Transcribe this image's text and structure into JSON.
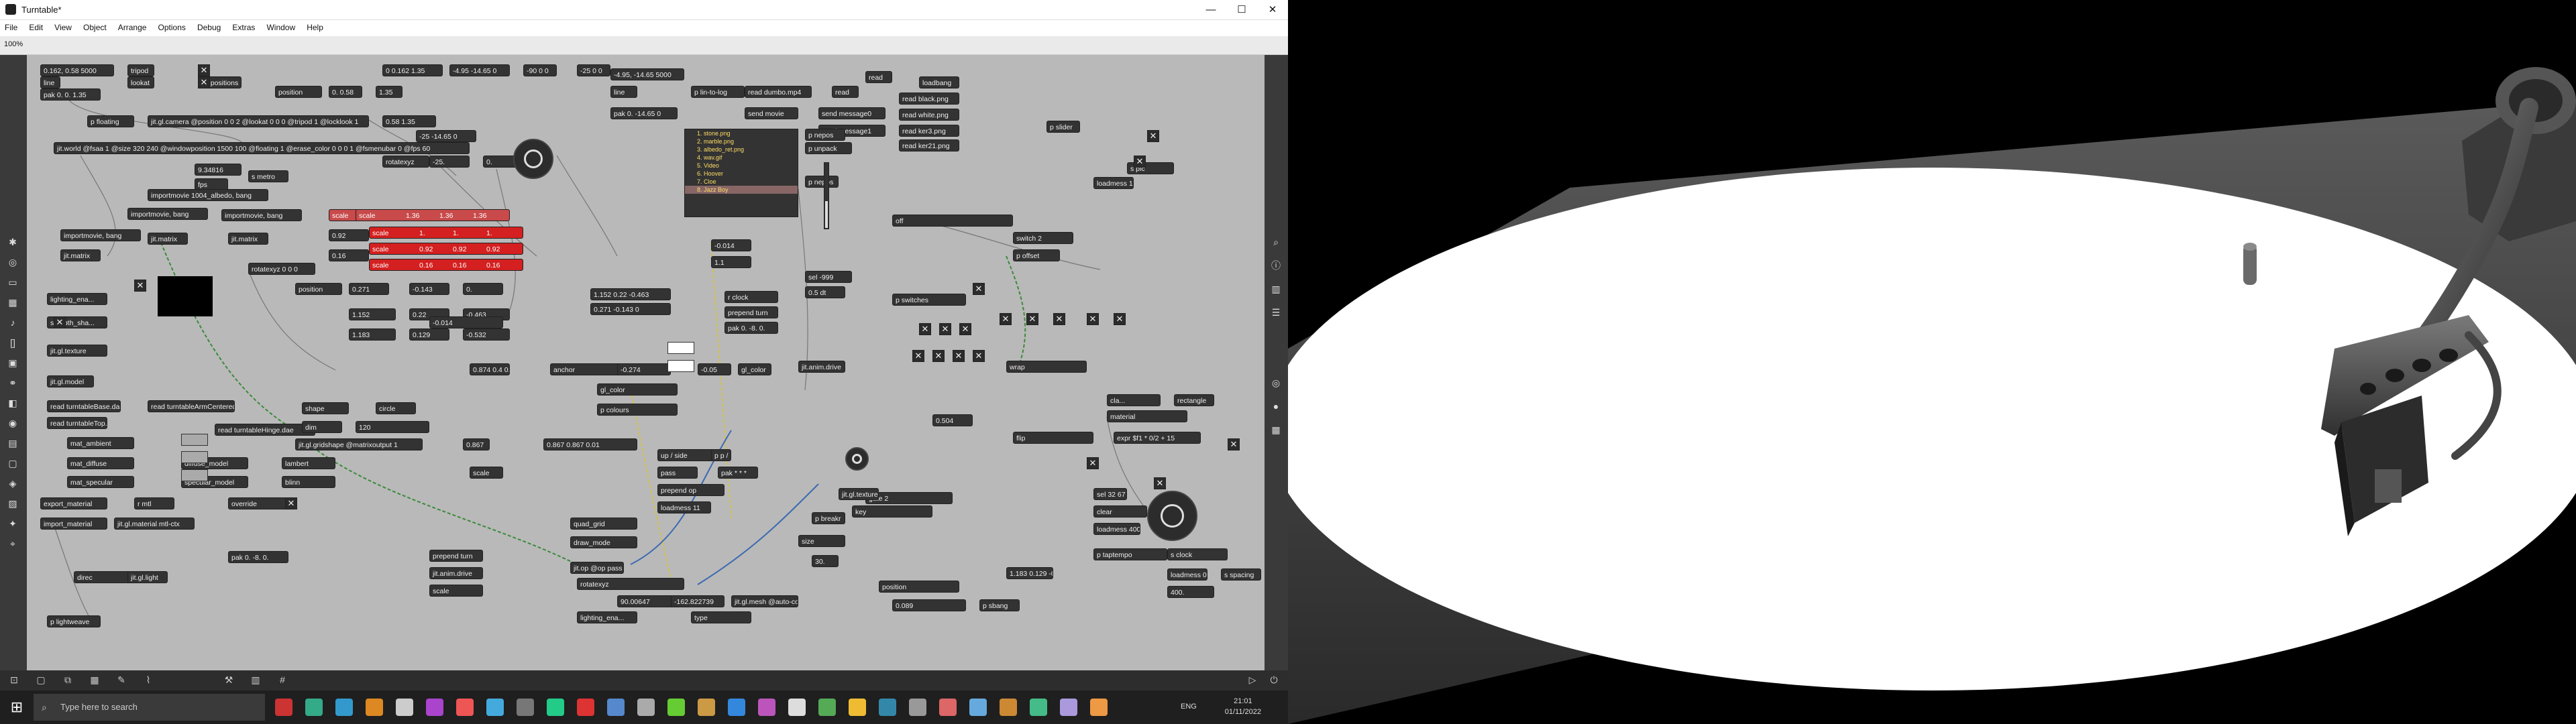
{
  "window": {
    "title": "Turntable*",
    "minimize": "—",
    "maximize": "☐",
    "close": "✕"
  },
  "menu": [
    "File",
    "Edit",
    "View",
    "Object",
    "Arrange",
    "Options",
    "Debug",
    "Extras",
    "Window",
    "Help"
  ],
  "toolbar": {
    "zoom": "100%"
  },
  "patch": {
    "objects": [
      {
        "t": "0.162, 0.58 5000"
      },
      {
        "t": "tripod"
      },
      {
        "t": "line"
      },
      {
        "t": "lookat"
      },
      {
        "t": "pak 0. 0. 1.35"
      },
      {
        "t": "p positions"
      },
      {
        "t": "position"
      },
      {
        "t": "0. 0.58"
      },
      {
        "t": "1.35"
      },
      {
        "t": "0 0.162 1.35"
      },
      {
        "t": "-4.95 -14.65 0"
      },
      {
        "t": "-90 0 0"
      },
      {
        "t": "-25 0 0"
      },
      {
        "t": "-4.95, -14.65 5000"
      },
      {
        "t": "line"
      },
      {
        "t": "pak 0. -14.65 0"
      },
      {
        "t": "p lin-to-log"
      },
      {
        "t": "read dumbo.mp4"
      },
      {
        "t": "send movie"
      },
      {
        "t": "send message0"
      },
      {
        "t": "send message1"
      },
      {
        "t": "read"
      },
      {
        "t": "read"
      },
      {
        "t": "loadbang"
      },
      {
        "t": "read black.png"
      },
      {
        "t": "read white.png"
      },
      {
        "t": "read ker3.png"
      },
      {
        "t": "read ker21.png"
      },
      {
        "t": "p floating"
      },
      {
        "t": "jit.gl.camera @position 0 0 2 @lookat 0 0 0 @tripod 1 @locklook 1"
      },
      {
        "t": "jit.world @fsaa 1 @size 320 240 @windowposition 1500 100 @floating 1 @erase_color 0 0 0 1 @fsmenubar 0 @fps 60"
      },
      {
        "t": "9.34816"
      },
      {
        "t": "fps"
      },
      {
        "t": "s metro"
      },
      {
        "t": "0.58 1.35"
      },
      {
        "t": "-25 -14.65 0"
      },
      {
        "t": "rotatexyz"
      },
      {
        "t": "-25."
      },
      {
        "t": "0."
      },
      {
        "t": "importmovie 1004_albedo, bang"
      },
      {
        "t": "importmovie, bang"
      },
      {
        "t": "importmovie, bang"
      },
      {
        "t": "importmovie, bang"
      },
      {
        "t": "jit.matrix"
      },
      {
        "t": "jit.matrix"
      },
      {
        "t": "jit.matrix"
      },
      {
        "t": "scale"
      },
      {
        "t": "1.36"
      },
      {
        "t": "0.92"
      },
      {
        "t": "0.16"
      },
      {
        "t": "rotatexyz 0 0 0"
      },
      {
        "t": "position"
      },
      {
        "t": "0.271"
      },
      {
        "t": "-0.143"
      },
      {
        "t": "0."
      },
      {
        "t": "1.152"
      },
      {
        "t": "0.22"
      },
      {
        "t": "-0.463"
      },
      {
        "t": "1.183"
      },
      {
        "t": "0.129"
      },
      {
        "t": "-0.532"
      },
      {
        "t": "lighting_ena..."
      },
      {
        "t": "smooth_sha..."
      },
      {
        "t": "jit.gl.texture"
      },
      {
        "t": "jit.gl.model"
      },
      {
        "t": "read turntableBase.dae"
      },
      {
        "t": "read turntableTop.dae"
      },
      {
        "t": "read turntableArmCentered.dae"
      },
      {
        "t": "read turntableHinge.dae"
      },
      {
        "t": "mat_ambient"
      },
      {
        "t": "mat_diffuse"
      },
      {
        "t": "mat_specular"
      },
      {
        "t": "diffuse_model"
      },
      {
        "t": "lambert"
      },
      {
        "t": "specular_model"
      },
      {
        "t": "blinn"
      },
      {
        "t": "export_material"
      },
      {
        "t": "import_material"
      },
      {
        "t": "override"
      },
      {
        "t": "r mtl"
      },
      {
        "t": "jit.gl.material mtl-ctx"
      },
      {
        "t": "shape"
      },
      {
        "t": "circle"
      },
      {
        "t": "dim"
      },
      {
        "t": "120"
      },
      {
        "t": "jit.gl.gridshape @matrixoutput 1"
      },
      {
        "t": "0.867"
      },
      {
        "t": "0.867 0.867 0.01"
      },
      {
        "t": "scale"
      },
      {
        "t": "up / side"
      },
      {
        "t": "p p /"
      },
      {
        "t": "pass"
      },
      {
        "t": "pak * * *"
      },
      {
        "t": "prepend op"
      },
      {
        "t": "loadmess 11"
      },
      {
        "t": "quad_grid"
      },
      {
        "t": "draw_mode"
      },
      {
        "t": "jit.op @op pass + pass"
      },
      {
        "t": "rotatexyz"
      },
      {
        "t": "90.00647"
      },
      {
        "t": "-162.822739"
      },
      {
        "t": "jit.gl.mesh @auto-colors 1"
      },
      {
        "t": "lighting_ena..."
      },
      {
        "t": "type"
      },
      {
        "t": "direc"
      },
      {
        "t": "jit.gl.light"
      },
      {
        "t": "p lightweave"
      },
      {
        "t": "pak 0. -8. 0."
      },
      {
        "t": "prepend turn"
      },
      {
        "t": "jit.anim.drive"
      },
      {
        "t": "scale"
      },
      {
        "t": "0.874 0.4 0.41"
      },
      {
        "t": "anchor"
      },
      {
        "t": "-0.274"
      },
      {
        "t": "-0.05"
      },
      {
        "t": "gl_color"
      },
      {
        "t": "gl_color"
      },
      {
        "t": "p colours"
      },
      {
        "t": "off"
      },
      {
        "t": "switch 2"
      },
      {
        "t": "p offset"
      },
      {
        "t": "p switches"
      },
      {
        "t": "wrap"
      },
      {
        "t": "cla..."
      },
      {
        "t": "rectangle"
      },
      {
        "t": "material"
      },
      {
        "t": "flip"
      },
      {
        "t": "expr $f1 * 0/2 + 15"
      },
      {
        "t": "gate 2"
      },
      {
        "t": "p breakr"
      },
      {
        "t": "size"
      },
      {
        "t": "30."
      },
      {
        "t": "jit.gl.texture"
      },
      {
        "t": "key"
      },
      {
        "t": "sel 32 67"
      },
      {
        "t": "clear"
      },
      {
        "t": "loadmess 400"
      },
      {
        "t": "p taptempo"
      },
      {
        "t": "s clock"
      },
      {
        "t": "s spacing"
      },
      {
        "t": "400."
      },
      {
        "t": "loadmess 0.089 0"
      },
      {
        "t": "position"
      },
      {
        "t": "0.089"
      },
      {
        "t": "p sbang"
      },
      {
        "t": "1.183 0.129 -0.532"
      },
      {
        "t": "1.152 0.22 -0.463"
      },
      {
        "t": "0.271 -0.143 0"
      },
      {
        "t": "-0.014"
      },
      {
        "t": "-0.014"
      },
      {
        "t": "1.1"
      },
      {
        "t": "0.504"
      },
      {
        "t": "jit.anim.drive"
      },
      {
        "t": "prepend turn"
      },
      {
        "t": "pak 0. -8. 0."
      },
      {
        "t": "r clock"
      },
      {
        "t": "loadmess 1"
      },
      {
        "t": "s pic"
      },
      {
        "t": "p slider"
      },
      {
        "t": "p unpack"
      },
      {
        "t": "sel -999"
      },
      {
        "t": "0.5 dt"
      },
      {
        "t": "p nepos"
      },
      {
        "t": "p nepos"
      }
    ],
    "umenu_items": [
      "1. stone.png",
      "2. marble.png",
      "3. albedo_ret.png",
      "4. wav.gif",
      "5. Video",
      "6. Hoover",
      "7. Cloe",
      "8. Jazz Boy"
    ],
    "selected_menu_index": 7,
    "scale_values": [
      "1.36",
      "1.36",
      "1.36"
    ],
    "scale_values2": [
      "1.",
      "1.",
      "1."
    ],
    "scale_values3": [
      "0.92",
      "0.92",
      "0.92"
    ],
    "scale_values4": [
      "0.16",
      "0.16",
      "0.16"
    ]
  },
  "taskbar": {
    "search_placeholder": "Type here to search",
    "tray_lang": "ENG",
    "time": "21:01",
    "date": "01/11/2022"
  },
  "render": {
    "description_hidden": ""
  },
  "colors": {
    "canvas_bg": "#b9b9b9",
    "object_bg": "#333333",
    "scale_red": "#d42020",
    "cable_green": "#3b8a3b",
    "cable_blue": "#3b6ab0",
    "cable_yellow": "#d0c050"
  },
  "icons": [
    "max-logo-icon",
    "minimize-icon",
    "maximize-icon",
    "close-icon",
    "start-icon",
    "search-icon",
    "dial-icon"
  ]
}
